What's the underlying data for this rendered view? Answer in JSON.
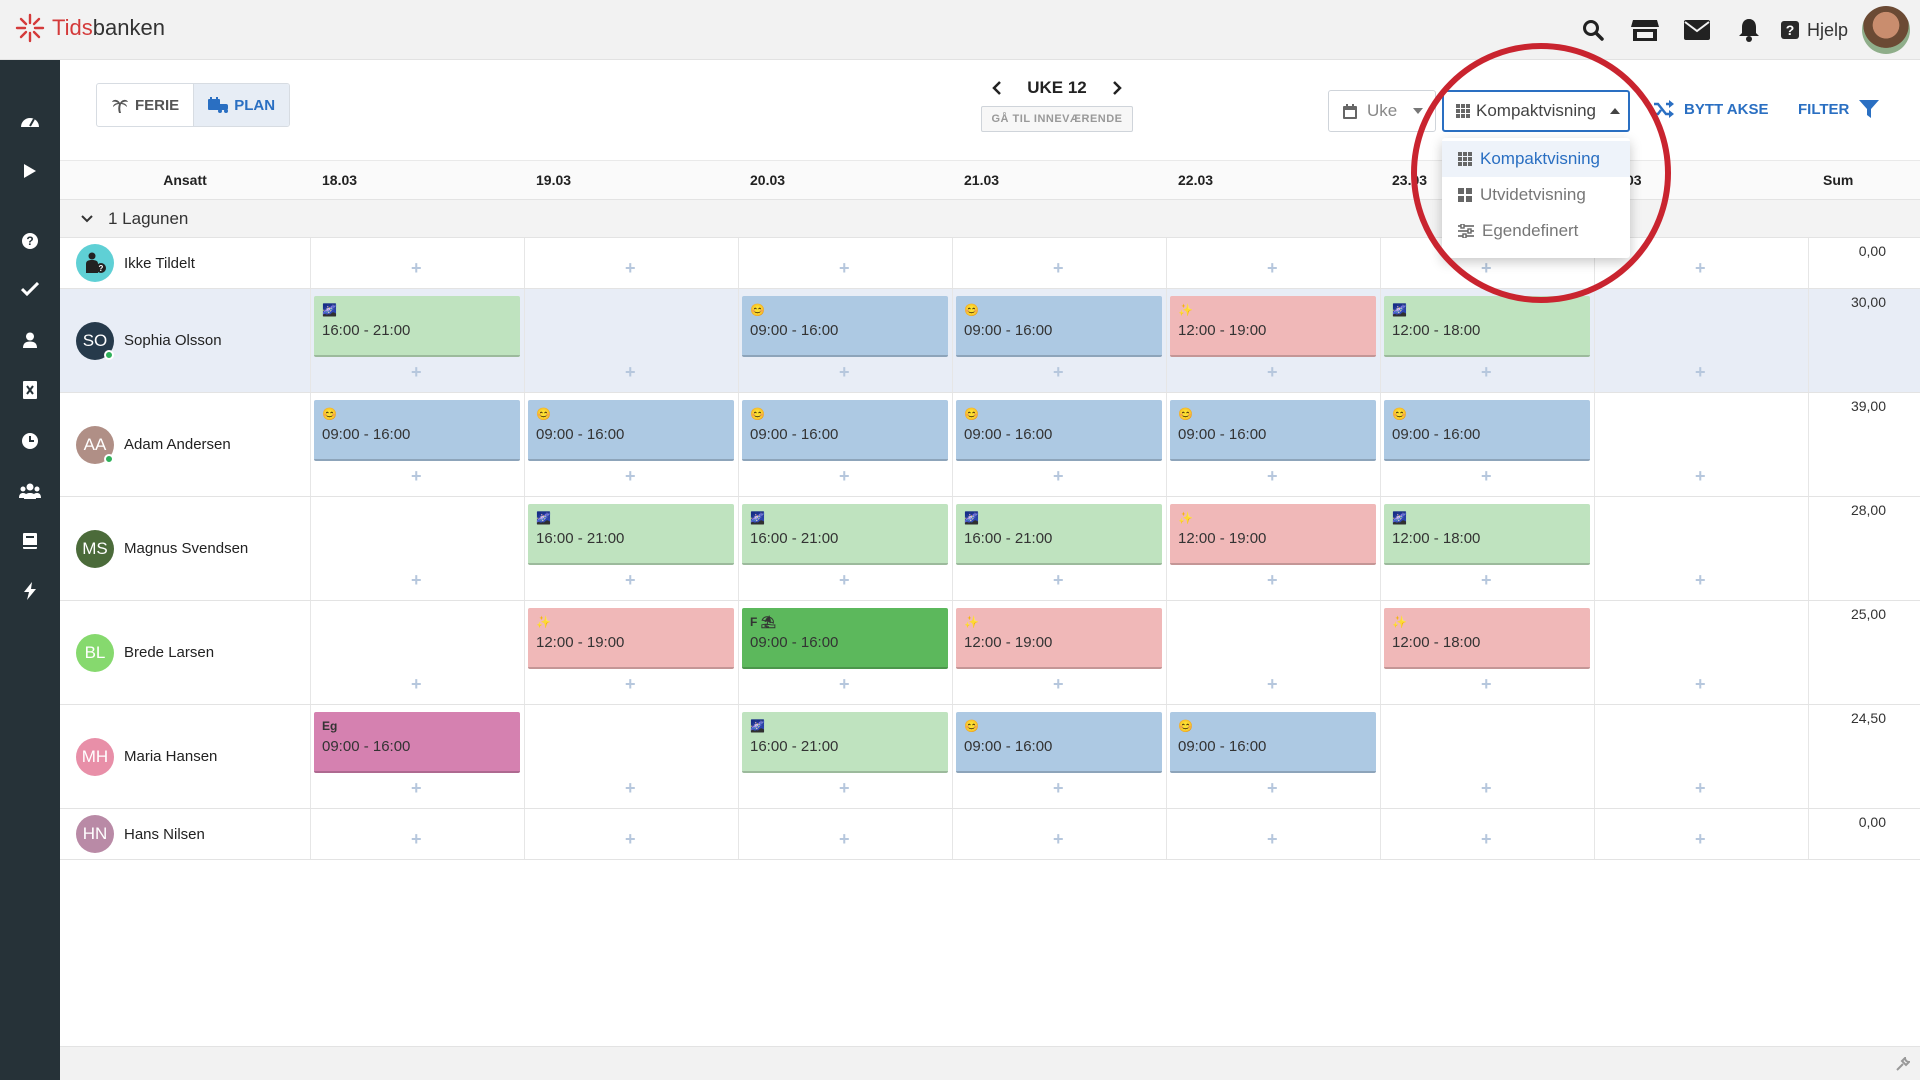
{
  "app": {
    "logo_prefix": "Tids",
    "logo_suffix": "banken",
    "help_label": "Hjelp"
  },
  "topbar_icons": [
    "search-icon",
    "store-icon",
    "mail-icon",
    "bell-icon"
  ],
  "sidebar_icons": [
    "dashboard-icon",
    "play-icon",
    "question-icon",
    "check-icon",
    "person-icon",
    "excel-icon",
    "clock-icon",
    "users-icon",
    "book-icon",
    "bolt-icon"
  ],
  "mode": {
    "ferie": "FERIE",
    "plan": "PLAN"
  },
  "week": {
    "label": "UKE 12",
    "today": "GÅ TIL INNEVÆRENDE"
  },
  "period_select": "Uke",
  "view_select": {
    "value": "Kompaktvisning",
    "options": [
      {
        "label": "Kompaktvisning",
        "icon": "grid-icon"
      },
      {
        "label": "Utvidetvisning",
        "icon": "blocks-icon"
      },
      {
        "label": "Egendefinert",
        "icon": "sliders-icon"
      }
    ]
  },
  "bytt_akse": "BYTT AKSE",
  "filter": "FILTER",
  "columns": {
    "employee": "Ansatt",
    "sum": "Sum",
    "visible_days": [
      "18.03",
      "19.03",
      "20.03",
      "21.03",
      "22.03",
      "23.03"
    ],
    "partial_day": "03"
  },
  "group": "1 Lagunen",
  "colors": {
    "green": "#bfe3bf",
    "blue": "#adc9e3",
    "red": "#f0b8b8",
    "darkgreen": "#5cb85c",
    "pink": "#d581b0",
    "accent": "#2a6fc2",
    "highlight": "#c9242f"
  },
  "employees": [
    {
      "initials": "",
      "name": "Ikke Tildelt",
      "sum": "0,00",
      "avatar": "#5fd0d5",
      "online": false,
      "shifts": []
    },
    {
      "initials": "SO",
      "name": "Sophia Olsson",
      "sum": "30,00",
      "avatar": "#263a4b",
      "online": true,
      "shifts": [
        {
          "day": 0,
          "color": "green",
          "icon": "🌌",
          "time": "16:00 - 21:00"
        },
        {
          "day": 2,
          "color": "blue",
          "icon": "😊",
          "time": "09:00 - 16:00"
        },
        {
          "day": 3,
          "color": "blue",
          "icon": "😊",
          "time": "09:00 - 16:00"
        },
        {
          "day": 4,
          "color": "red",
          "icon": "✨",
          "time": "12:00 - 19:00"
        },
        {
          "day": 5,
          "color": "green",
          "icon": "🌌",
          "time": "12:00 - 18:00"
        }
      ]
    },
    {
      "initials": "AA",
      "name": "Adam Andersen",
      "sum": "39,00",
      "avatar": "#b08f86",
      "online": true,
      "shifts": [
        {
          "day": 0,
          "color": "blue",
          "icon": "😊",
          "time": "09:00 - 16:00"
        },
        {
          "day": 1,
          "color": "blue",
          "icon": "😊",
          "time": "09:00 - 16:00"
        },
        {
          "day": 2,
          "color": "blue",
          "icon": "😊",
          "time": "09:00 - 16:00"
        },
        {
          "day": 3,
          "color": "blue",
          "icon": "😊",
          "time": "09:00 - 16:00"
        },
        {
          "day": 4,
          "color": "blue",
          "icon": "😊",
          "time": "09:00 - 16:00"
        },
        {
          "day": 5,
          "color": "blue",
          "icon": "😊",
          "time": "09:00 - 16:00"
        }
      ]
    },
    {
      "initials": "MS",
      "name": "Magnus Svendsen",
      "sum": "28,00",
      "avatar": "#4b6b3a",
      "online": false,
      "shifts": [
        {
          "day": 1,
          "color": "green",
          "icon": "🌌",
          "time": "16:00 - 21:00"
        },
        {
          "day": 2,
          "color": "green",
          "icon": "🌌",
          "time": "16:00 - 21:00"
        },
        {
          "day": 3,
          "color": "green",
          "icon": "🌌",
          "time": "16:00 - 21:00"
        },
        {
          "day": 4,
          "color": "red",
          "icon": "✨",
          "time": "12:00 - 19:00"
        },
        {
          "day": 5,
          "color": "green",
          "icon": "🌌",
          "time": "12:00 - 18:00"
        }
      ]
    },
    {
      "initials": "BL",
      "name": "Brede Larsen",
      "sum": "25,00",
      "avatar": "#86d96e",
      "online": false,
      "shifts": [
        {
          "day": 1,
          "color": "red",
          "icon": "✨",
          "time": "12:00 - 19:00"
        },
        {
          "day": 2,
          "color": "darkgreen",
          "icon": "F ⛱",
          "time": "09:00 - 16:00"
        },
        {
          "day": 3,
          "color": "red",
          "icon": "✨",
          "time": "12:00 - 19:00"
        },
        {
          "day": 5,
          "color": "red",
          "icon": "✨",
          "time": "12:00 - 18:00"
        }
      ]
    },
    {
      "initials": "MH",
      "name": "Maria Hansen",
      "sum": "24,50",
      "avatar": "#e88fa8",
      "online": false,
      "shifts": [
        {
          "day": 0,
          "color": "pink",
          "icon": "Eg",
          "time": "09:00 - 16:00"
        },
        {
          "day": 2,
          "color": "green",
          "icon": "🌌",
          "time": "16:00 - 21:00"
        },
        {
          "day": 3,
          "color": "blue",
          "icon": "😊",
          "time": "09:00 - 16:00"
        },
        {
          "day": 4,
          "color": "blue",
          "icon": "😊",
          "time": "09:00 - 16:00"
        }
      ]
    },
    {
      "initials": "HN",
      "name": "Hans Nilsen",
      "sum": "0,00",
      "avatar": "#b98aa6",
      "online": false,
      "shifts": []
    }
  ]
}
